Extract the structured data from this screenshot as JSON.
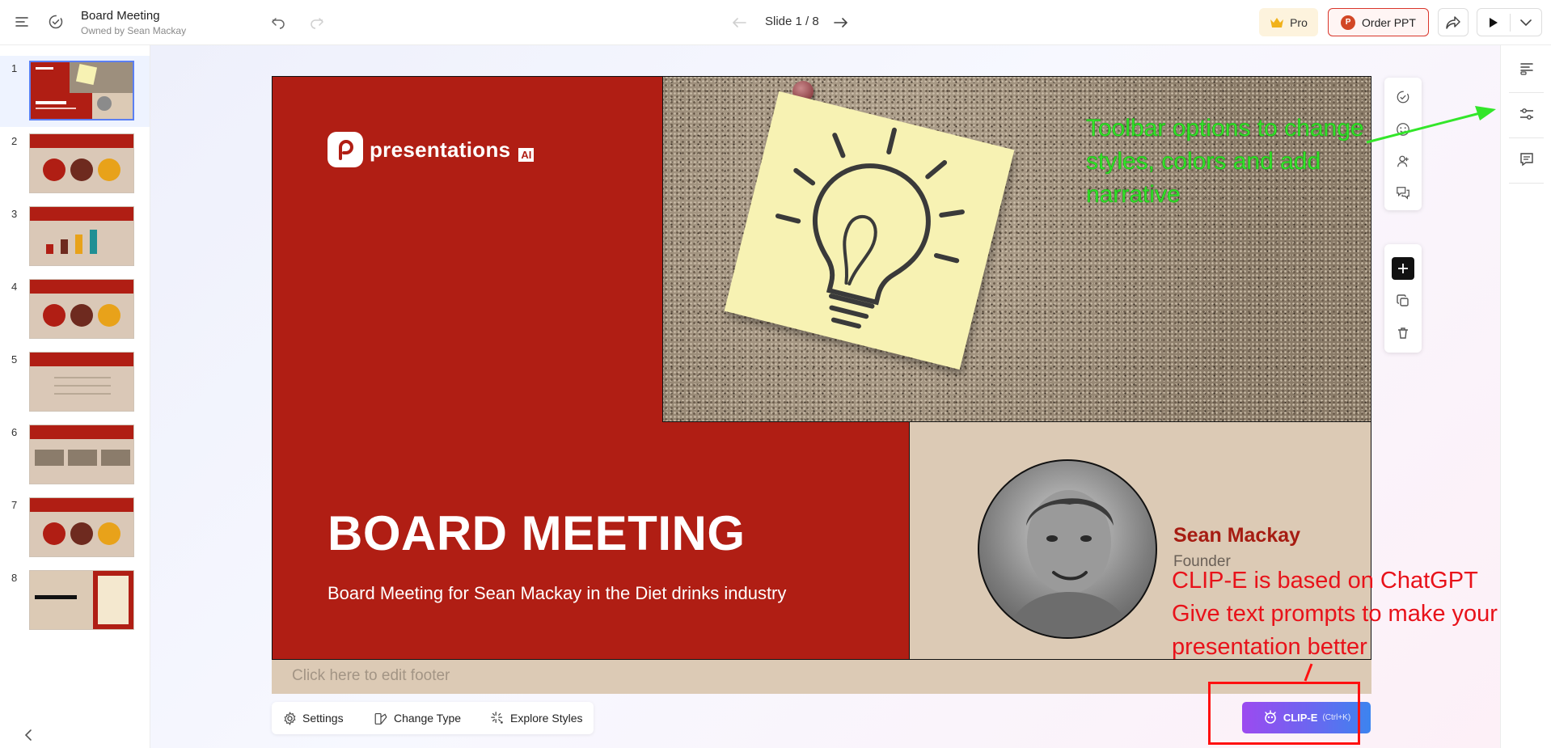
{
  "header": {
    "doc_title": "Board Meeting",
    "doc_owner": "Owned by Sean Mackay",
    "slide_counter": "Slide 1 / 8",
    "pro_label": "Pro",
    "order_label": "Order PPT",
    "ppt_badge": "P"
  },
  "thumbnails": [
    {
      "number": "1"
    },
    {
      "number": "2"
    },
    {
      "number": "3"
    },
    {
      "number": "4"
    },
    {
      "number": "5"
    },
    {
      "number": "6"
    },
    {
      "number": "7"
    },
    {
      "number": "8"
    }
  ],
  "slide": {
    "logo_text": "presentations",
    "logo_suffix": "AI",
    "title": "BOARD MEETING",
    "subtitle": "Board Meeting for Sean Mackay in the Diet drinks industry",
    "person_name": "Sean Mackay",
    "person_role": "Founder",
    "footer_placeholder": "Click here to edit footer"
  },
  "bottom_toolbar": {
    "settings_label": "Settings",
    "change_type_label": "Change Type",
    "explore_styles_label": "Explore Styles"
  },
  "clip": {
    "label": "CLIP-E",
    "shortcut": "(Ctrl+K)"
  },
  "annotations": {
    "green": "Toolbar options to change styles, colors and add narrative",
    "red_line1": "CLIP-E is based on ChatGPT",
    "red_line2": "Give text prompts to make your",
    "red_line3": "presentation better"
  },
  "colors": {
    "slide_red": "#b01e14",
    "slide_beige": "#dccab5",
    "annotation_green": "#33e62a",
    "annotation_red": "#e8121a",
    "clip_gradient_start": "#9c4af0",
    "clip_gradient_end": "#3c84ef"
  },
  "icons": {
    "menu": "hamburger-icon",
    "history": "history-check-icon",
    "undo": "undo-icon",
    "redo": "redo-icon",
    "prev": "arrow-left-icon",
    "next": "arrow-right-icon",
    "pro": "crown-icon",
    "share": "share-icon",
    "play": "play-icon",
    "dropdown": "chevron-down-icon"
  }
}
